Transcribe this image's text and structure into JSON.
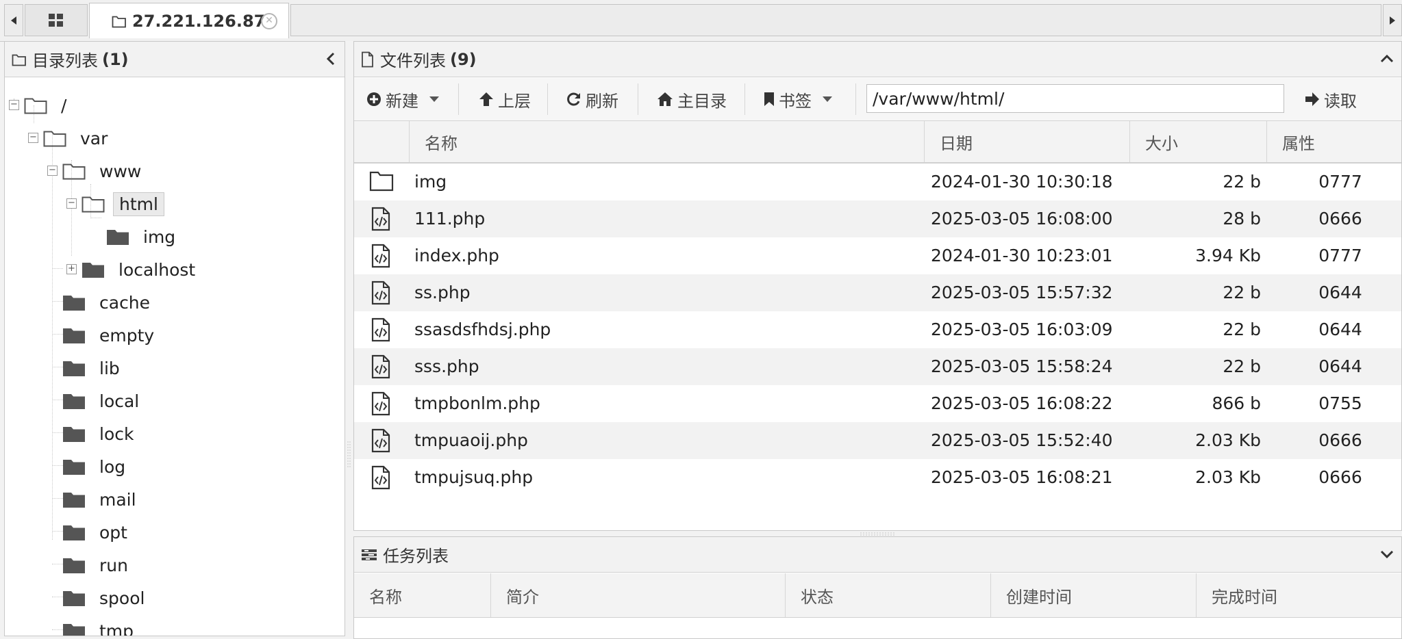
{
  "tabs": {
    "active_title": "27.221.126.87"
  },
  "tree_panel": {
    "title": "目录列表",
    "count": "(1)",
    "nodes": [
      {
        "label": "/",
        "depth": 0
      },
      {
        "label": "var",
        "depth": 1
      },
      {
        "label": "www",
        "depth": 2
      },
      {
        "label": "html",
        "depth": 3,
        "selected": true
      },
      {
        "label": "img",
        "depth": 4
      },
      {
        "label": "localhost",
        "depth": 3
      },
      {
        "label": "cache",
        "depth": 2
      },
      {
        "label": "empty",
        "depth": 2
      },
      {
        "label": "lib",
        "depth": 2
      },
      {
        "label": "local",
        "depth": 2
      },
      {
        "label": "lock",
        "depth": 2
      },
      {
        "label": "log",
        "depth": 2
      },
      {
        "label": "mail",
        "depth": 2
      },
      {
        "label": "opt",
        "depth": 2
      },
      {
        "label": "run",
        "depth": 2
      },
      {
        "label": "spool",
        "depth": 2
      },
      {
        "label": "tmp",
        "depth": 2
      }
    ]
  },
  "file_panel": {
    "title": "文件列表",
    "count": "(9)",
    "toolbar": {
      "new_label": "新建",
      "up_label": "上层",
      "refresh_label": "刷新",
      "home_label": "主目录",
      "bookmark_label": "书签",
      "path_value": "/var/www/html/",
      "read_label": "读取"
    },
    "columns": {
      "name": "名称",
      "date": "日期",
      "size": "大小",
      "perm": "属性"
    },
    "rows": [
      {
        "type": "folder",
        "name": "img",
        "date": "2024-01-30 10:30:18",
        "size": "22 b",
        "perm": "0777"
      },
      {
        "type": "code",
        "name": "111.php",
        "date": "2025-03-05 16:08:00",
        "size": "28 b",
        "perm": "0666"
      },
      {
        "type": "code",
        "name": "index.php",
        "date": "2024-01-30 10:23:01",
        "size": "3.94 Kb",
        "perm": "0777"
      },
      {
        "type": "code",
        "name": "ss.php",
        "date": "2025-03-05 15:57:32",
        "size": "22 b",
        "perm": "0644"
      },
      {
        "type": "code",
        "name": "ssasdsfhdsj.php",
        "date": "2025-03-05 16:03:09",
        "size": "22 b",
        "perm": "0644"
      },
      {
        "type": "code",
        "name": "sss.php",
        "date": "2025-03-05 15:58:24",
        "size": "22 b",
        "perm": "0644"
      },
      {
        "type": "code",
        "name": "tmpbonlm.php",
        "date": "2025-03-05 16:08:22",
        "size": "866 b",
        "perm": "0755"
      },
      {
        "type": "code",
        "name": "tmpuaoij.php",
        "date": "2025-03-05 15:52:40",
        "size": "2.03 Kb",
        "perm": "0666"
      },
      {
        "type": "code",
        "name": "tmpujsuq.php",
        "date": "2025-03-05 16:08:21",
        "size": "2.03 Kb",
        "perm": "0666"
      }
    ]
  },
  "task_panel": {
    "title": "任务列表",
    "columns": {
      "name": "名称",
      "summary": "简介",
      "status": "状态",
      "created": "创建时间",
      "finished": "完成时间"
    }
  }
}
